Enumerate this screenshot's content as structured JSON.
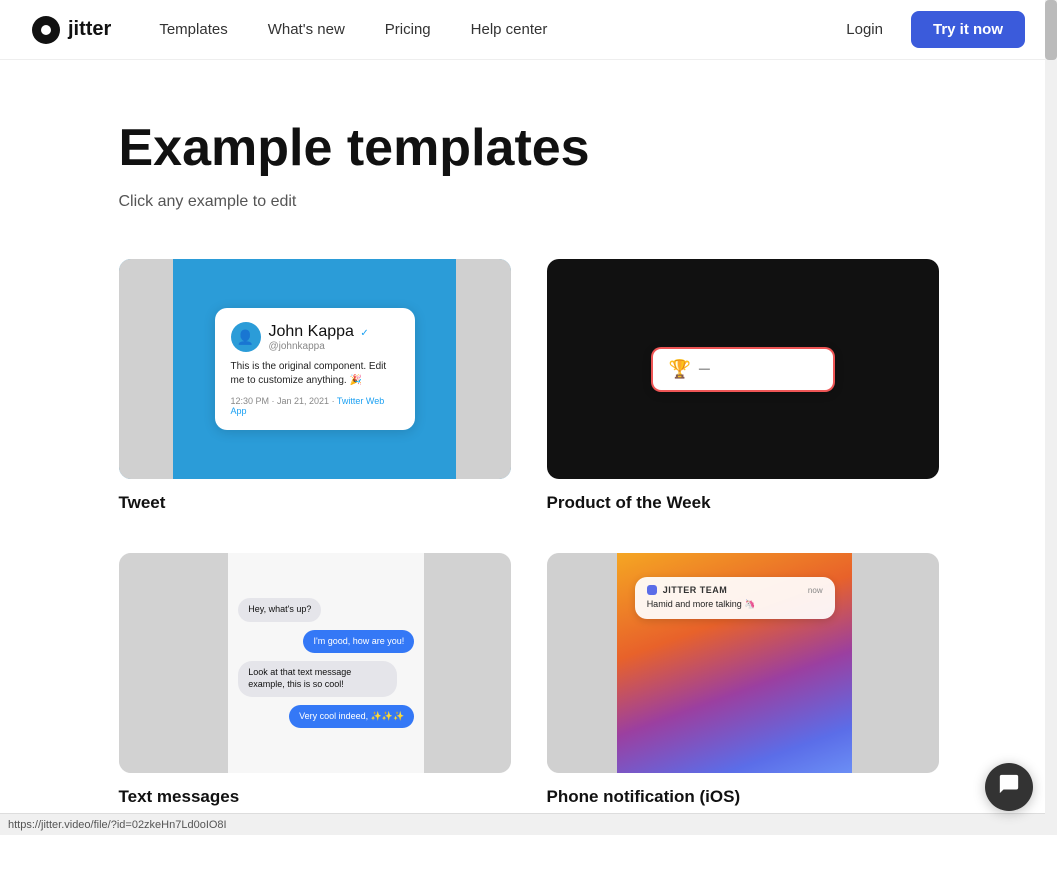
{
  "nav": {
    "logo_text": "jitter",
    "links": [
      {
        "label": "Templates",
        "id": "templates"
      },
      {
        "label": "What's new",
        "id": "whats-new"
      },
      {
        "label": "Pricing",
        "id": "pricing"
      },
      {
        "label": "Help center",
        "id": "help-center"
      }
    ],
    "login_label": "Login",
    "cta_label": "Try it now"
  },
  "page": {
    "title": "Example templates",
    "subtitle": "Click any example to edit"
  },
  "templates": [
    {
      "id": "tweet",
      "label": "Tweet",
      "type": "tweet",
      "tweet": {
        "name": "John Kappa",
        "handle": "@johnkappa",
        "body": "This is the original component. Edit me to customize anything. 🎉",
        "meta": "12:30 PM · Jan 21, 2021 · Twitter Web App"
      }
    },
    {
      "id": "product-of-week",
      "label": "Product of the Week",
      "type": "potw",
      "potw": {
        "emoji": "🏆",
        "text": "—"
      }
    },
    {
      "id": "text-messages",
      "label": "Text messages",
      "type": "messages",
      "messages": [
        {
          "text": "Hey, what's up?",
          "type": "received"
        },
        {
          "text": "I'm good, how are you!",
          "type": "sent"
        },
        {
          "text": "Look at that text message example, this is so cool!",
          "type": "received"
        },
        {
          "text": "Very cool indeed, ✨✨✨",
          "type": "sent"
        }
      ]
    },
    {
      "id": "phone-notification",
      "label": "Phone notification (iOS)",
      "type": "phone",
      "phone": {
        "app": "Jitter Team",
        "body": "Hamid and more talking 🦄",
        "time": "now"
      }
    }
  ],
  "status_bar": {
    "url": "https://jitter.video/file/?id=02zkeHn7Ld0oIO8I"
  },
  "chat_widget": {
    "icon": "💬"
  }
}
